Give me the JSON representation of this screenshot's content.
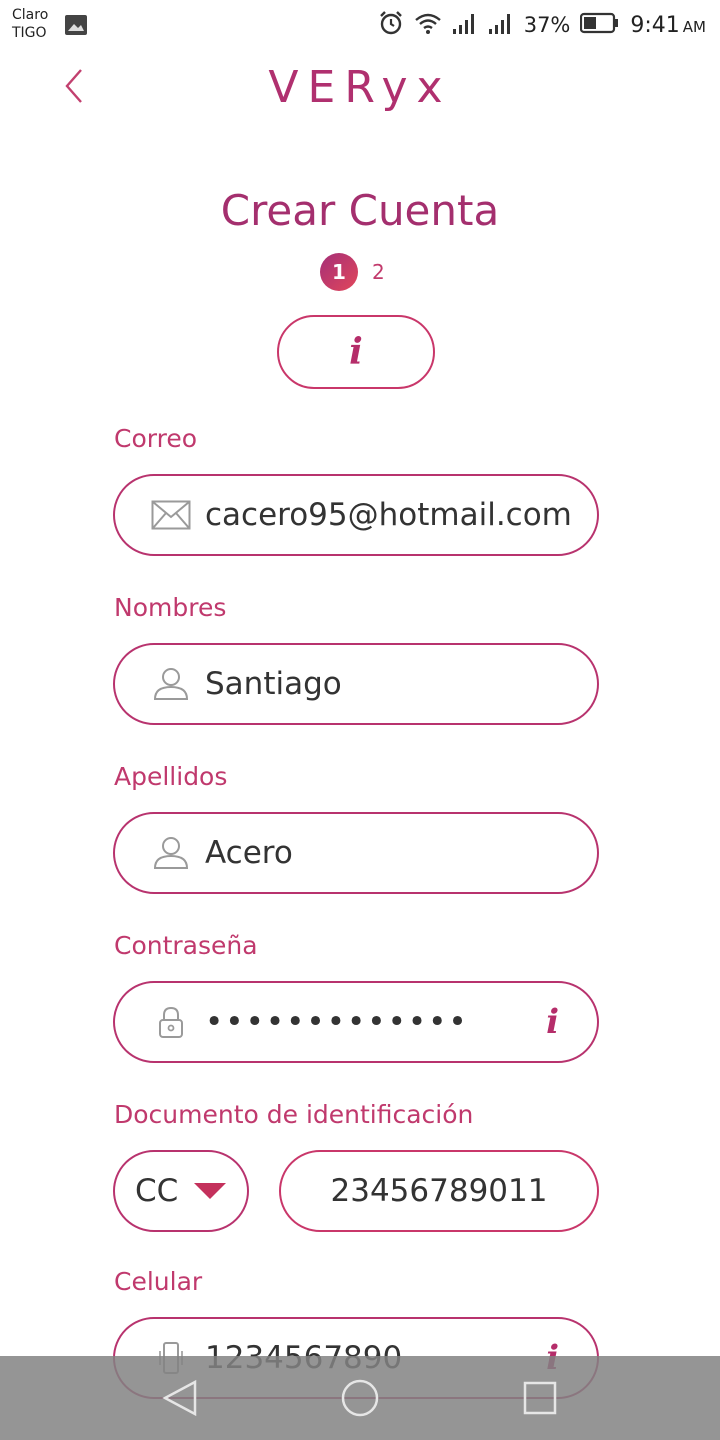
{
  "status_bar": {
    "carrier_1": "Claro",
    "carrier_2": "TIGO",
    "battery_percent": "37%",
    "time": "9:41",
    "ampm": "AM",
    "icons": [
      "image-icon",
      "alarm-icon",
      "wifi-icon",
      "signal-icon",
      "signal-icon",
      "battery-icon"
    ]
  },
  "header": {
    "brand": "VERyx",
    "back_icon": "chevron-left-icon"
  },
  "title": "Crear Cuenta",
  "steps": {
    "current": "1",
    "next": "2"
  },
  "info_button": {
    "glyph": "i"
  },
  "form": {
    "email": {
      "label": "Correo",
      "value": "cacero95@hotmail.com",
      "icon": "envelope-icon"
    },
    "first_name": {
      "label": "Nombres",
      "value": "Santiago",
      "icon": "user-icon"
    },
    "last_name": {
      "label": "Apellidos",
      "value": "Acero",
      "icon": "user-icon"
    },
    "password": {
      "label": "Contraseña",
      "value": "•••••••••••••",
      "icon": "lock-icon",
      "info_glyph": "i"
    },
    "document": {
      "label": "Documento de identificación",
      "type": "CC",
      "number": "23456789011"
    },
    "phone": {
      "label": "Celular",
      "value": "1234567890",
      "icon": "phone-icon",
      "info_glyph": "i"
    }
  },
  "colors": {
    "accent": "#b8336e",
    "accent_light": "#e2475a",
    "text": "#333333"
  },
  "nav_bar": {
    "icons": [
      "back-triangle-icon",
      "home-circle-icon",
      "recents-square-icon"
    ]
  }
}
